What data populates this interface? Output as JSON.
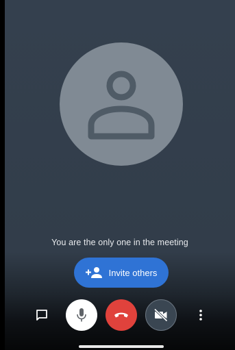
{
  "meeting": {
    "status_text": "You are the only one in the meeting",
    "invite_label": "Invite others"
  },
  "controls": {
    "chat_icon": "chat-icon",
    "mic_icon": "mic-icon",
    "end_call_icon": "call-end-icon",
    "video_icon": "video-off-icon",
    "more_icon": "more-vert-icon"
  },
  "colors": {
    "background": "#34404e",
    "avatar": "#808a94",
    "invite_button": "#2f73d5",
    "end_call": "#e0423c",
    "mic_button": "#ffffff"
  }
}
